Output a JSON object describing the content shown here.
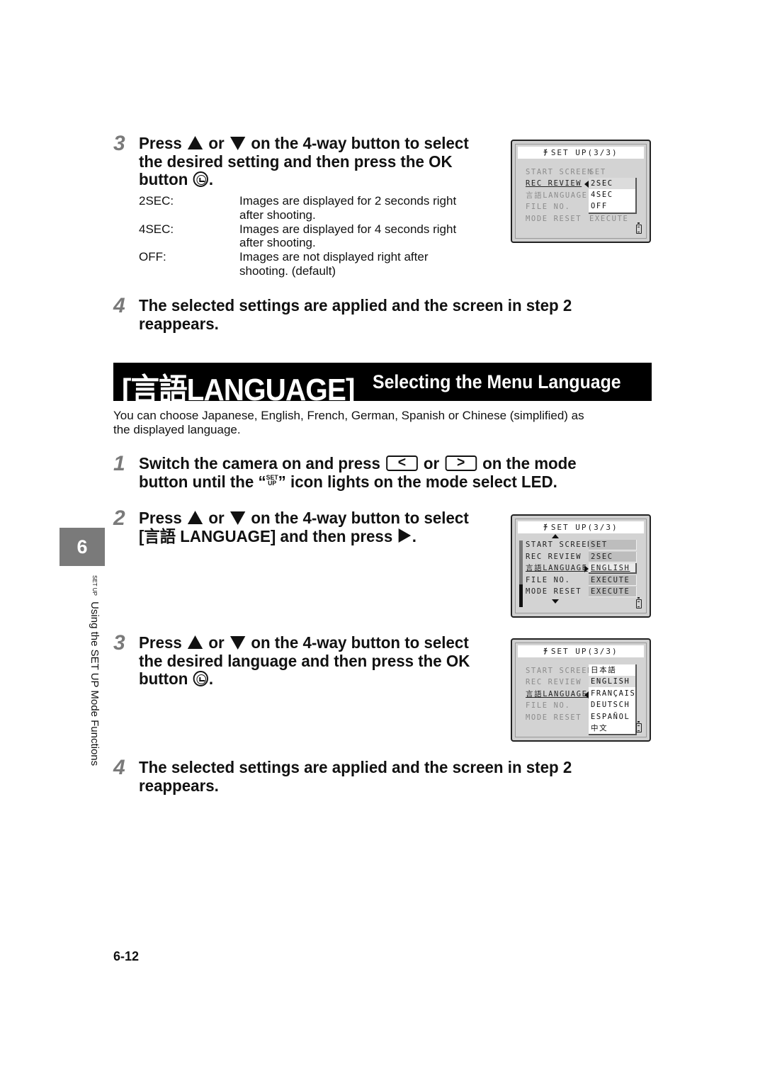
{
  "top_section": {
    "step3": {
      "number": "3",
      "line1_a": "Press",
      "line1_or": "or",
      "line1_b": "on the 4-way button to select",
      "line2": "the desired setting and then press the OK",
      "line3": "button",
      "line3_end": "."
    },
    "options": [
      {
        "term": "2SEC:",
        "desc_line1": "Images are displayed for 2 seconds right",
        "desc_line2": "after shooting."
      },
      {
        "term": "4SEC:",
        "desc_line1": "Images are displayed for 4 seconds right",
        "desc_line2": "after shooting."
      },
      {
        "term": "OFF:",
        "desc_line1": "Images are not displayed right after",
        "desc_line2": "shooting. (default)"
      }
    ],
    "step4": {
      "number": "4",
      "line1": "The selected settings are applied and the screen in step 2",
      "line2": "reappears."
    },
    "lcd": {
      "title": "SET UP(3/3)",
      "rows": [
        "START SCREEN",
        "REC REVIEW",
        "言語LANGUAGE",
        "FILE NO.",
        "MODE RESET"
      ],
      "values": [
        "SET",
        "",
        "",
        "",
        "EXECUTE"
      ],
      "popup": [
        "2SEC",
        "4SEC",
        "OFF"
      ],
      "selected_row": "REC REVIEW",
      "highlighted_option": "2SEC"
    }
  },
  "section": {
    "title_main": "[言語LANGUAGE]",
    "title_sub": "Selecting the Menu Language",
    "intro_line1": "You can choose Japanese, English, French, German, Spanish or Chinese (simplified) as",
    "intro_line2": "the displayed language."
  },
  "steps": {
    "step1": {
      "number": "1",
      "line1_a": "Switch the camera on and press",
      "key_left": "<",
      "or": "or",
      "key_right": ">",
      "line1_b": "on the mode",
      "line2_a": "button until the “",
      "setup_icon_top": "SET",
      "setup_icon_bottom": "UP",
      "line2_b": "” icon lights on the mode select LED."
    },
    "step2": {
      "number": "2",
      "line1_a": "Press",
      "line1_or": "or",
      "line1_b": "on the 4-way button to select",
      "line2_a": "[言語 LANGUAGE] and then press",
      "line2_end": ".",
      "lcd": {
        "title": "SET UP(3/3)",
        "rows": [
          "START SCREEN",
          "REC REVIEW",
          "言語LANGUAGE",
          "FILE NO.",
          "MODE RESET"
        ],
        "values": [
          "SET",
          "2SEC",
          "ENGLISH",
          "EXECUTE",
          "EXECUTE"
        ],
        "selected_row": "言語LANGUAGE"
      }
    },
    "step3": {
      "number": "3",
      "line1_a": "Press",
      "line1_or": "or",
      "line1_b": "on the 4-way button to select",
      "line2": "the desired language and then press the OK",
      "line3": "button",
      "line3_end": ".",
      "lcd": {
        "title": "SET UP(3/3)",
        "rows": [
          "START SCREEN",
          "REC REVIEW",
          "言語LANGUAGE",
          "FILE NO.",
          "MODE RESET"
        ],
        "popup": [
          "日本語",
          "ENGLISH",
          "FRANÇAIS",
          "DEUTSCH",
          "ESPAÑOL",
          "中文"
        ],
        "selected_row": "言語LANGUAGE",
        "highlighted_option": "ENGLISH"
      }
    },
    "step4": {
      "number": "4",
      "line1": "The selected settings are applied and the screen in step 2",
      "line2": "reappears."
    }
  },
  "sidebar": {
    "chapter": "6",
    "setup_icon_top": "SET",
    "setup_icon_bottom": "UP",
    "label": "Using the SET UP Mode Functions"
  },
  "footer": {
    "page_number": "6-12"
  }
}
